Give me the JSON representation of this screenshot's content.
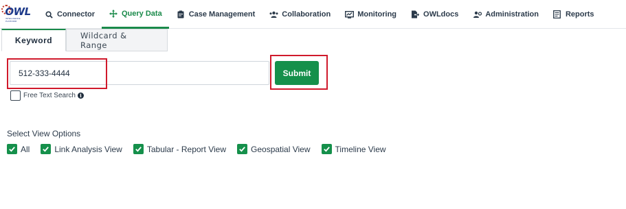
{
  "nav": {
    "logo_text": "OWL",
    "logo_subtext": "INTELLIGENCE PLATFORM",
    "items": [
      {
        "label": "Connector",
        "icon": "search-icon"
      },
      {
        "label": "Query Data",
        "icon": "move-arrows-icon",
        "active": true
      },
      {
        "label": "Case Management",
        "icon": "clipboard-icon"
      },
      {
        "label": "Collaboration",
        "icon": "users-icon"
      },
      {
        "label": "Monitoring",
        "icon": "monitor-chart-icon"
      },
      {
        "label": "OWLdocs",
        "icon": "document-export-icon"
      },
      {
        "label": "Administration",
        "icon": "users-cog-icon"
      },
      {
        "label": "Reports",
        "icon": "report-icon"
      }
    ]
  },
  "tabs": [
    {
      "label": "Keyword",
      "active": true
    },
    {
      "label": "Wildcard & Range",
      "active": false
    }
  ],
  "search": {
    "value": "512-333-4444",
    "submit_label": "Submit",
    "free_text_label": "Free Text Search",
    "free_text_checked": false
  },
  "view_options": {
    "title": "Select View Options",
    "items": [
      {
        "label": "All",
        "checked": true
      },
      {
        "label": "Link Analysis View",
        "checked": true
      },
      {
        "label": "Tabular - Report View",
        "checked": true
      },
      {
        "label": "Geospatial View",
        "checked": true
      },
      {
        "label": "Timeline View",
        "checked": true
      }
    ]
  },
  "colors": {
    "accent": "#15904b",
    "highlight": "#d0192b"
  }
}
